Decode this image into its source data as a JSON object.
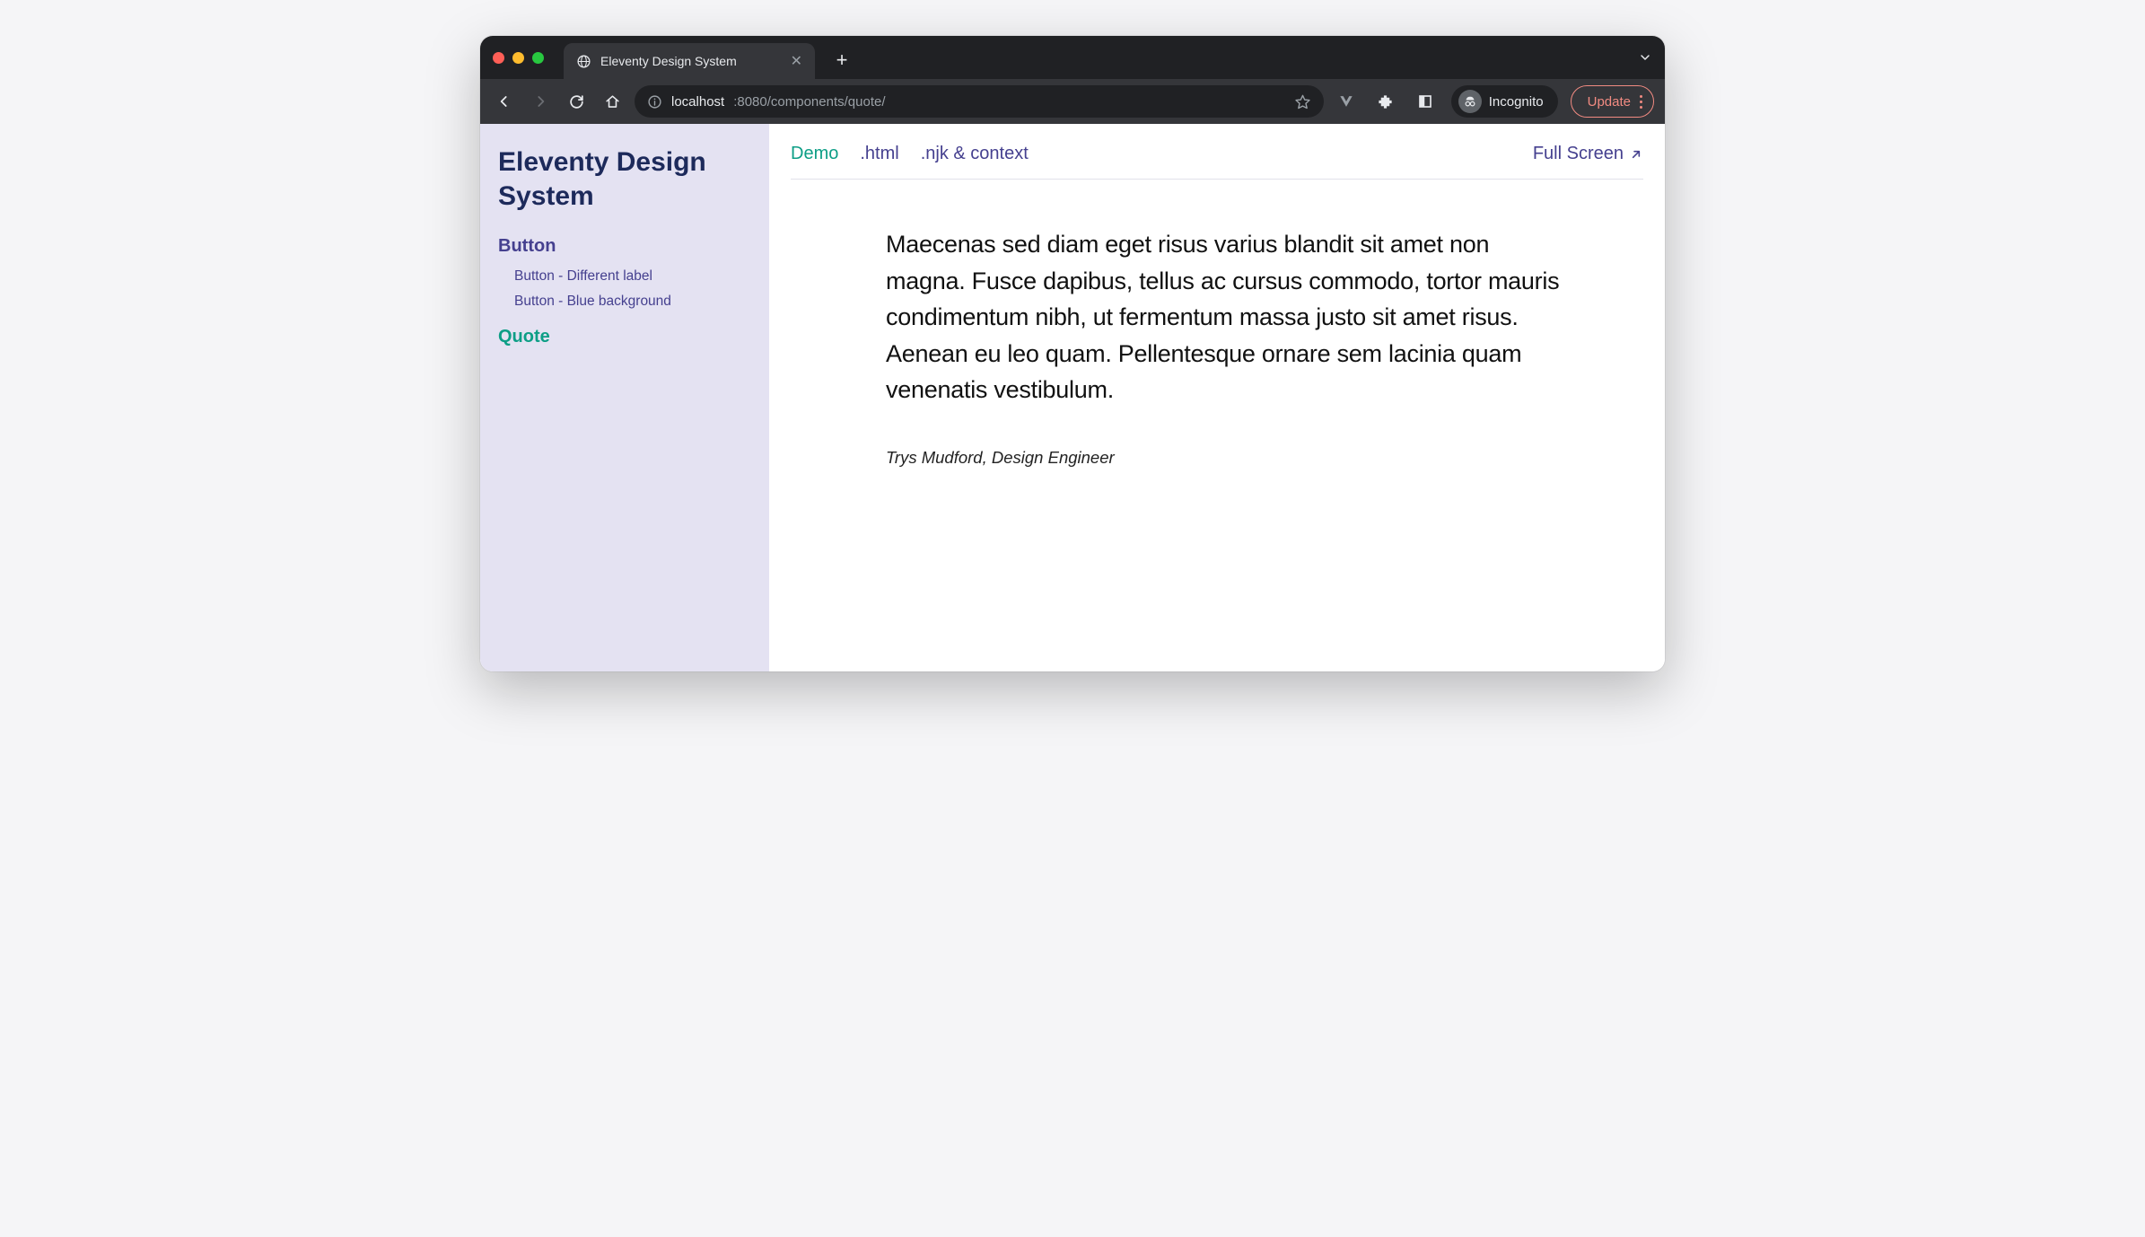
{
  "browser": {
    "tab_title": "Eleventy Design System",
    "url_host": "localhost",
    "url_rest": ":8080/components/quote/",
    "incognito_label": "Incognito",
    "update_label": "Update"
  },
  "sidebar": {
    "title": "Eleventy Design System",
    "groups": [
      {
        "label": "Button",
        "active": false,
        "items": [
          {
            "label": "Button - Different label"
          },
          {
            "label": "Button - Blue background"
          }
        ]
      },
      {
        "label": "Quote",
        "active": true,
        "items": []
      }
    ]
  },
  "main": {
    "tabs": [
      {
        "label": "Demo",
        "active": true
      },
      {
        "label": ".html",
        "active": false
      },
      {
        "label": ".njk & context",
        "active": false
      }
    ],
    "full_screen_label": "Full Screen",
    "quote": {
      "body": "Maecenas sed diam eget risus varius blandit sit amet non magna. Fusce dapibus, tellus ac cursus commodo, tortor mauris condimentum nibh, ut fermentum massa justo sit amet risus. Aenean eu leo quam. Pellentesque ornare sem lacinia quam venenatis vestibulum.",
      "citation": "Trys Mudford, Design Engineer"
    }
  }
}
